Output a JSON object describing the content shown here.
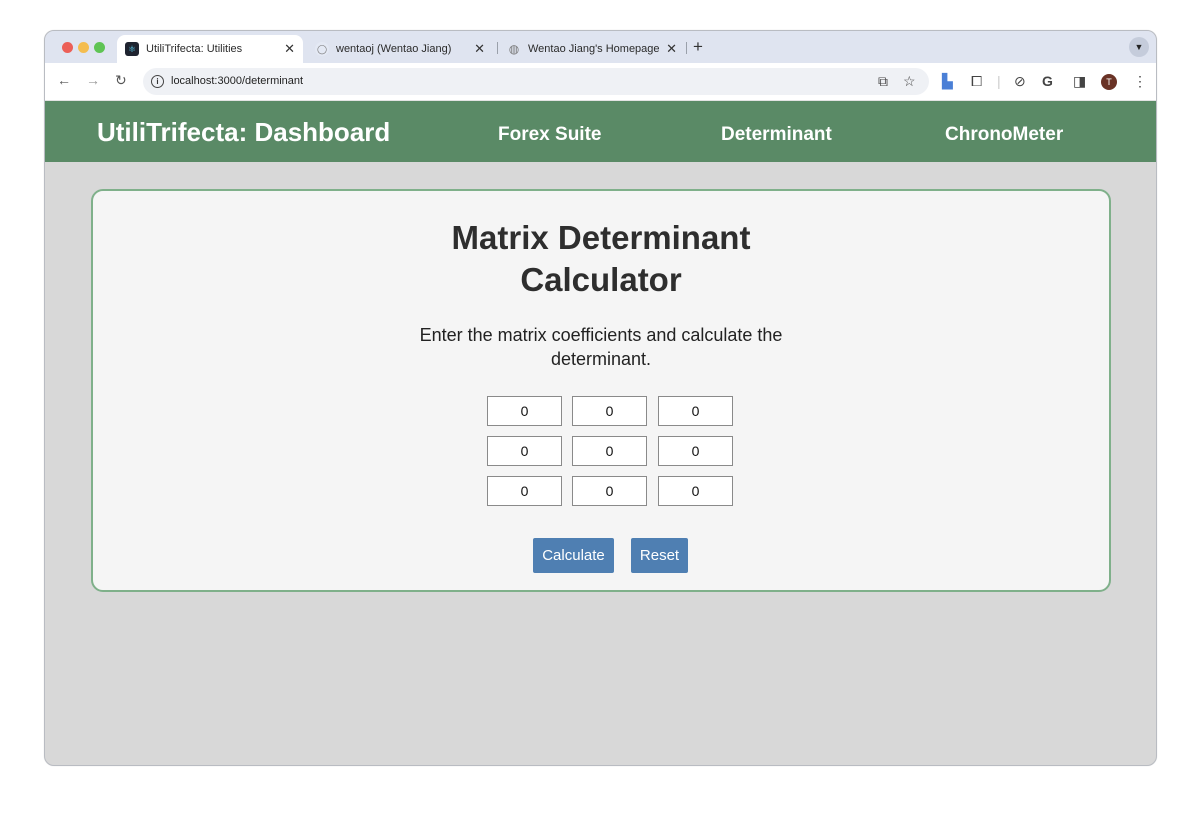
{
  "browser": {
    "tabs": [
      {
        "title": "UtiliTrifecta: Utilities",
        "active": true,
        "favicon": "react-icon"
      },
      {
        "title": "wentaoj (Wentao Jiang)",
        "active": false,
        "favicon": "github-icon"
      },
      {
        "title": "Wentao Jiang's Homepage",
        "active": false,
        "favicon": "globe-icon"
      }
    ],
    "url": "localhost:3000/determinant",
    "avatar_letter": "T"
  },
  "header": {
    "brand": "UtiliTrifecta: Dashboard",
    "links": [
      "Forex Suite",
      "Determinant",
      "ChronoMeter"
    ]
  },
  "main": {
    "title_line1": "Matrix Determinant",
    "title_line2": "Calculator",
    "instructions": "Enter the matrix coefficients and calculate the determinant.",
    "matrix": [
      [
        "0",
        "0",
        "0"
      ],
      [
        "0",
        "0",
        "0"
      ],
      [
        "0",
        "0",
        "0"
      ]
    ],
    "calculate_label": "Calculate",
    "reset_label": "Reset"
  },
  "colors": {
    "nav_bg": "#5a8a66",
    "card_border": "#7fb08a",
    "button_bg": "#4f7fb2",
    "page_bg": "#d8d8d8"
  }
}
